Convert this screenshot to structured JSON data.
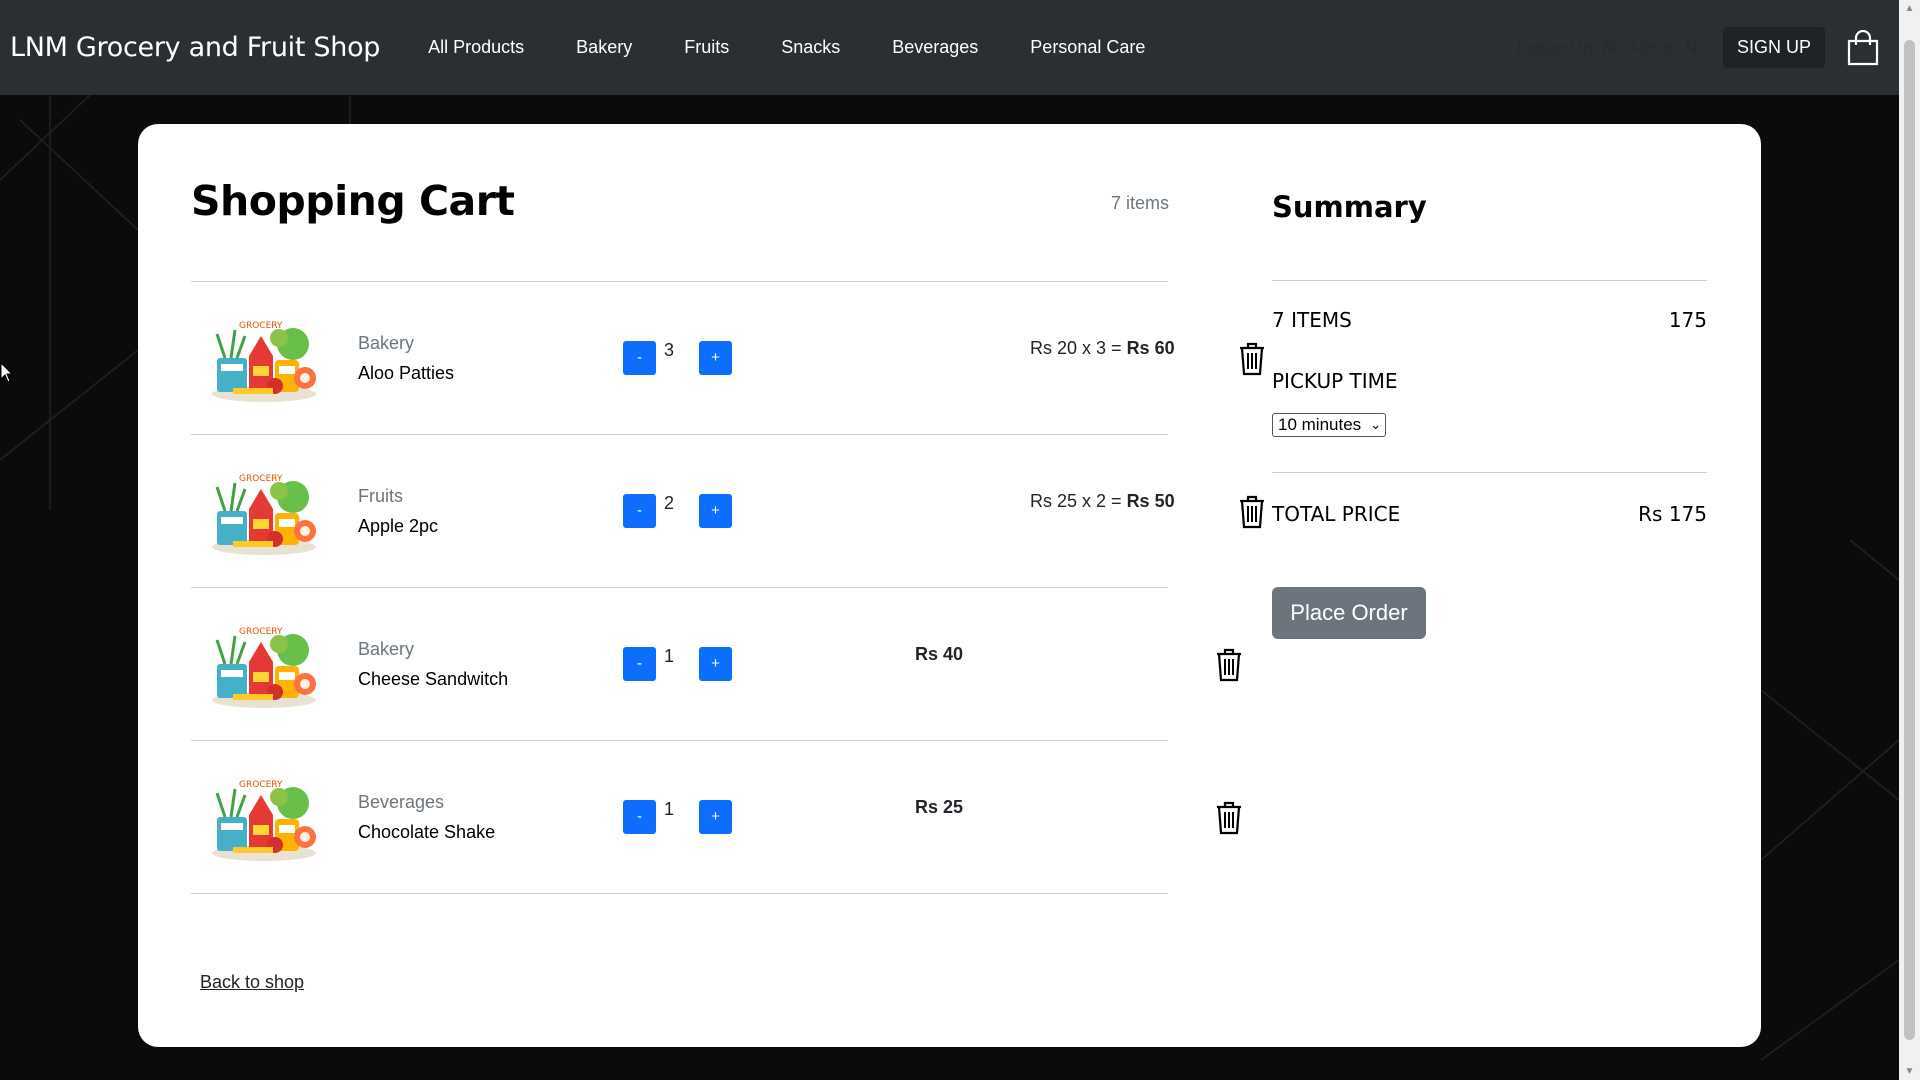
{
  "brand": "LNM Grocery and Fruit Shop",
  "nav": {
    "links": [
      "All Products",
      "Bakery",
      "Fruits",
      "Snacks",
      "Beverages",
      "Personal Care"
    ],
    "login_status": "Logged In: No Admin: No",
    "signup_label": "SIGN UP",
    "cart_icon": "shopping-bag-icon"
  },
  "cart": {
    "title": "Shopping Cart",
    "items_count": "7 items",
    "rows": [
      {
        "category": "Bakery",
        "name": "Aloo Patties",
        "qty": "3",
        "price_calc": "Rs 20 x 3 = ",
        "price_total": "Rs 60"
      },
      {
        "category": "Fruits",
        "name": "Apple 2pc",
        "qty": "2",
        "price_calc": "Rs 25 x 2 = ",
        "price_total": "Rs 50"
      },
      {
        "category": "Bakery",
        "name": "Cheese Sandwitch",
        "qty": "1",
        "price_calc": "",
        "price_total": "Rs 40"
      },
      {
        "category": "Beverages",
        "name": "Chocolate Shake",
        "qty": "1",
        "price_calc": "",
        "price_total": "Rs 25"
      }
    ],
    "minus_label": "-",
    "plus_label": "+",
    "back_link": "Back to shop"
  },
  "summary": {
    "title": "Summary",
    "items_label": "7 ITEMS",
    "items_value": "175",
    "pickup_label": "PICKUP TIME",
    "pickup_selected": "10 minutes",
    "total_label": "TOTAL PRICE",
    "total_value": "Rs 175",
    "place_order_label": "Place Order"
  },
  "colors": {
    "navbar": "#2b2f33",
    "accent_blue": "#0d6efd",
    "place_order_bg": "#6c757d",
    "page_bg": "#0b0b0c"
  }
}
